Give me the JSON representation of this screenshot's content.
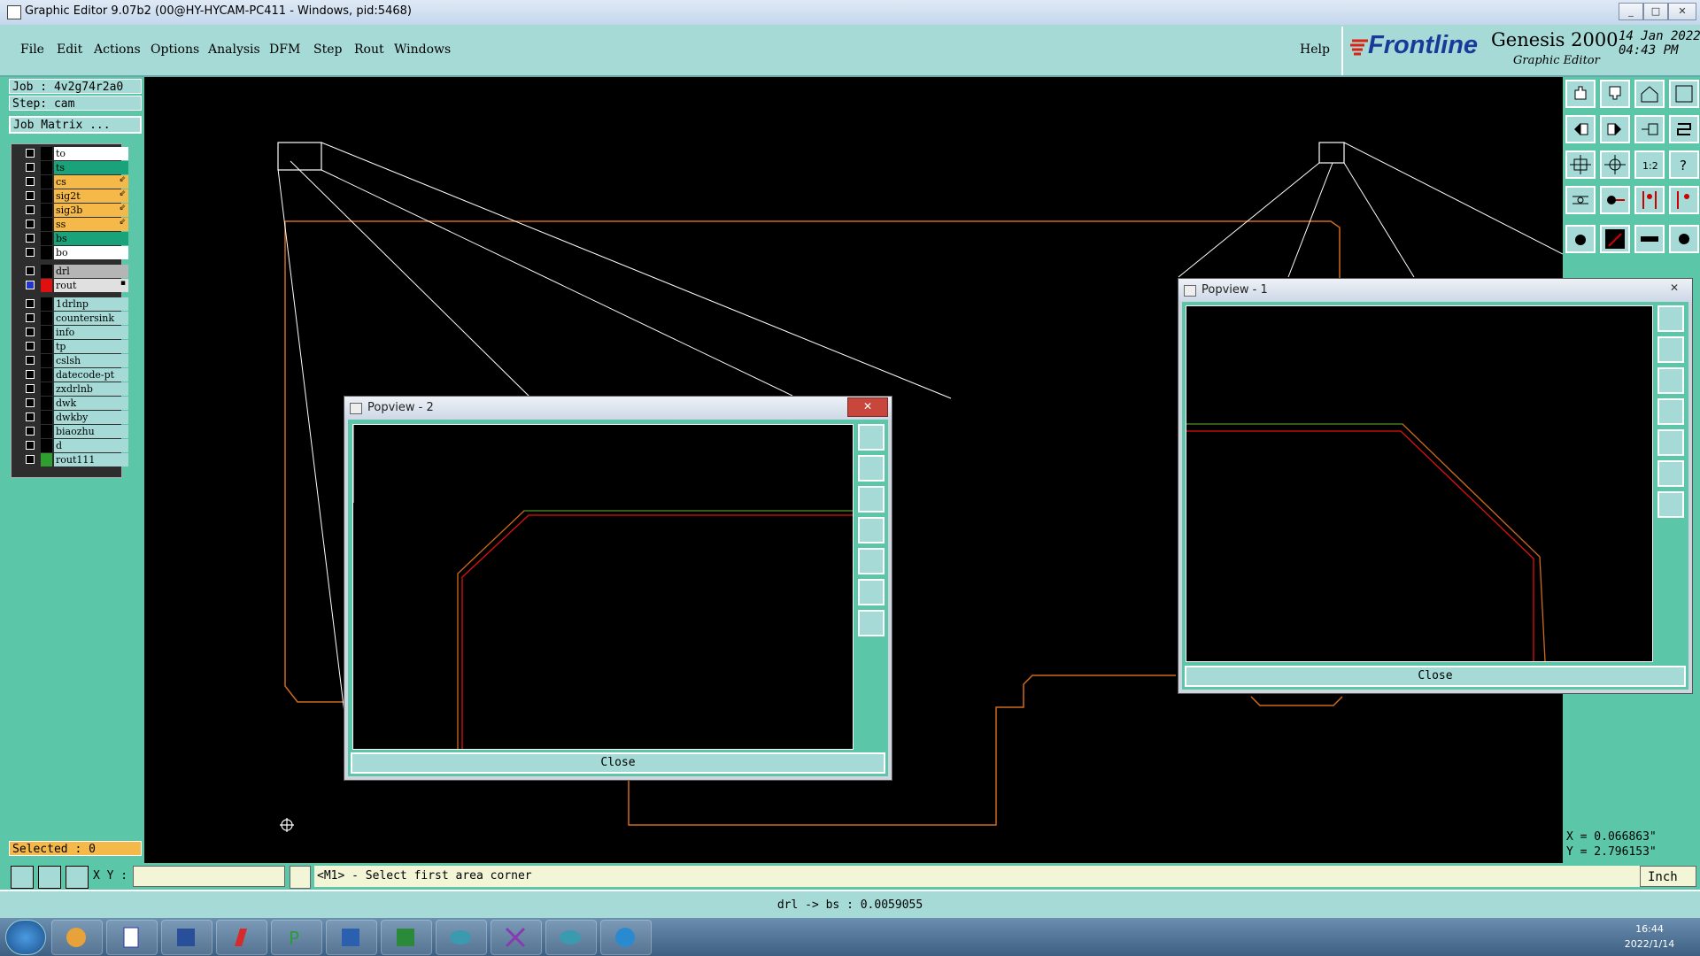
{
  "window": {
    "title": "Graphic Editor 9.07b2 (00@HY-HYCAM-PC411 - Windows, pid:5468)",
    "min": "_",
    "max": "□",
    "close": "✕"
  },
  "menu": [
    "File",
    "Edit",
    "Actions",
    "Options",
    "Analysis",
    "DFM",
    "Step",
    "Rout",
    "Windows"
  ],
  "help": "Help",
  "branding": {
    "brand": "Frontline",
    "product": "Genesis 2000",
    "subtitle": "Graphic Editor",
    "date": "14 Jan 2022",
    "time": "04:43 PM"
  },
  "job": {
    "job": "Job : 4v2g74r2a0",
    "step": "Step: cam",
    "matrix": "Job Matrix ..."
  },
  "layers_group1": [
    {
      "name": "to",
      "color": "#ffffff",
      "swatch": "#000000",
      "mark": ""
    },
    {
      "name": "ts",
      "color": "#1aa37a",
      "swatch": "#000000",
      "mark": ""
    },
    {
      "name": "cs",
      "color": "#f5b94a",
      "swatch": "#000000",
      "mark": "⇙"
    },
    {
      "name": "sig2t",
      "color": "#f5b94a",
      "swatch": "#000000",
      "mark": "⇙"
    },
    {
      "name": "sig3b",
      "color": "#f5b94a",
      "swatch": "#000000",
      "mark": "⇙"
    },
    {
      "name": "ss",
      "color": "#f5b94a",
      "swatch": "#000000",
      "mark": "⇙"
    },
    {
      "name": "bs",
      "color": "#1aa37a",
      "swatch": "#000000",
      "mark": ""
    },
    {
      "name": "bo",
      "color": "#ffffff",
      "swatch": "#000000",
      "mark": ""
    }
  ],
  "layers_group2": [
    {
      "name": "drl",
      "color": "#b5b5b5",
      "swatch": "#000000",
      "mark": ""
    },
    {
      "name": "rout",
      "color": "#e0e0e0",
      "swatch": "#e01010",
      "mark": "▪"
    }
  ],
  "layers_group3": [
    {
      "name": "1drlnp",
      "color": "#a5dad6",
      "swatch": "#000000"
    },
    {
      "name": "countersink",
      "color": "#a5dad6",
      "swatch": "#000000"
    },
    {
      "name": "info",
      "color": "#a5dad6",
      "swatch": "#000000"
    },
    {
      "name": "tp",
      "color": "#a5dad6",
      "swatch": "#000000"
    },
    {
      "name": "cslsh",
      "color": "#a5dad6",
      "swatch": "#000000"
    },
    {
      "name": "datecode-pt",
      "color": "#a5dad6",
      "swatch": "#000000"
    },
    {
      "name": "zxdrlnb",
      "color": "#a5dad6",
      "swatch": "#000000"
    },
    {
      "name": "dwk",
      "color": "#a5dad6",
      "swatch": "#000000"
    },
    {
      "name": "dwkby",
      "color": "#a5dad6",
      "swatch": "#000000"
    },
    {
      "name": "biaozhu",
      "color": "#a5dad6",
      "swatch": "#000000"
    },
    {
      "name": "d",
      "color": "#a5dad6",
      "swatch": "#000000"
    },
    {
      "name": "rout111",
      "color": "#a5dad6",
      "swatch": "#2e9e2e"
    }
  ],
  "selected": "Selected : 0",
  "popview1": {
    "title": "Popview - 1",
    "close": "Close"
  },
  "popview2": {
    "title": "Popview - 2",
    "close": "Close"
  },
  "coords": {
    "x": "X = 0.066863\"",
    "y": "Y = 2.796153\""
  },
  "cmd": {
    "xy_label": "X Y :",
    "xy_value": "",
    "prompt": "<M1> - Select first area corner",
    "unit": "Inch"
  },
  "status": "drl -> bs : 0.0059055",
  "tray": {
    "time": "16:44",
    "date": "2022/1/14"
  }
}
